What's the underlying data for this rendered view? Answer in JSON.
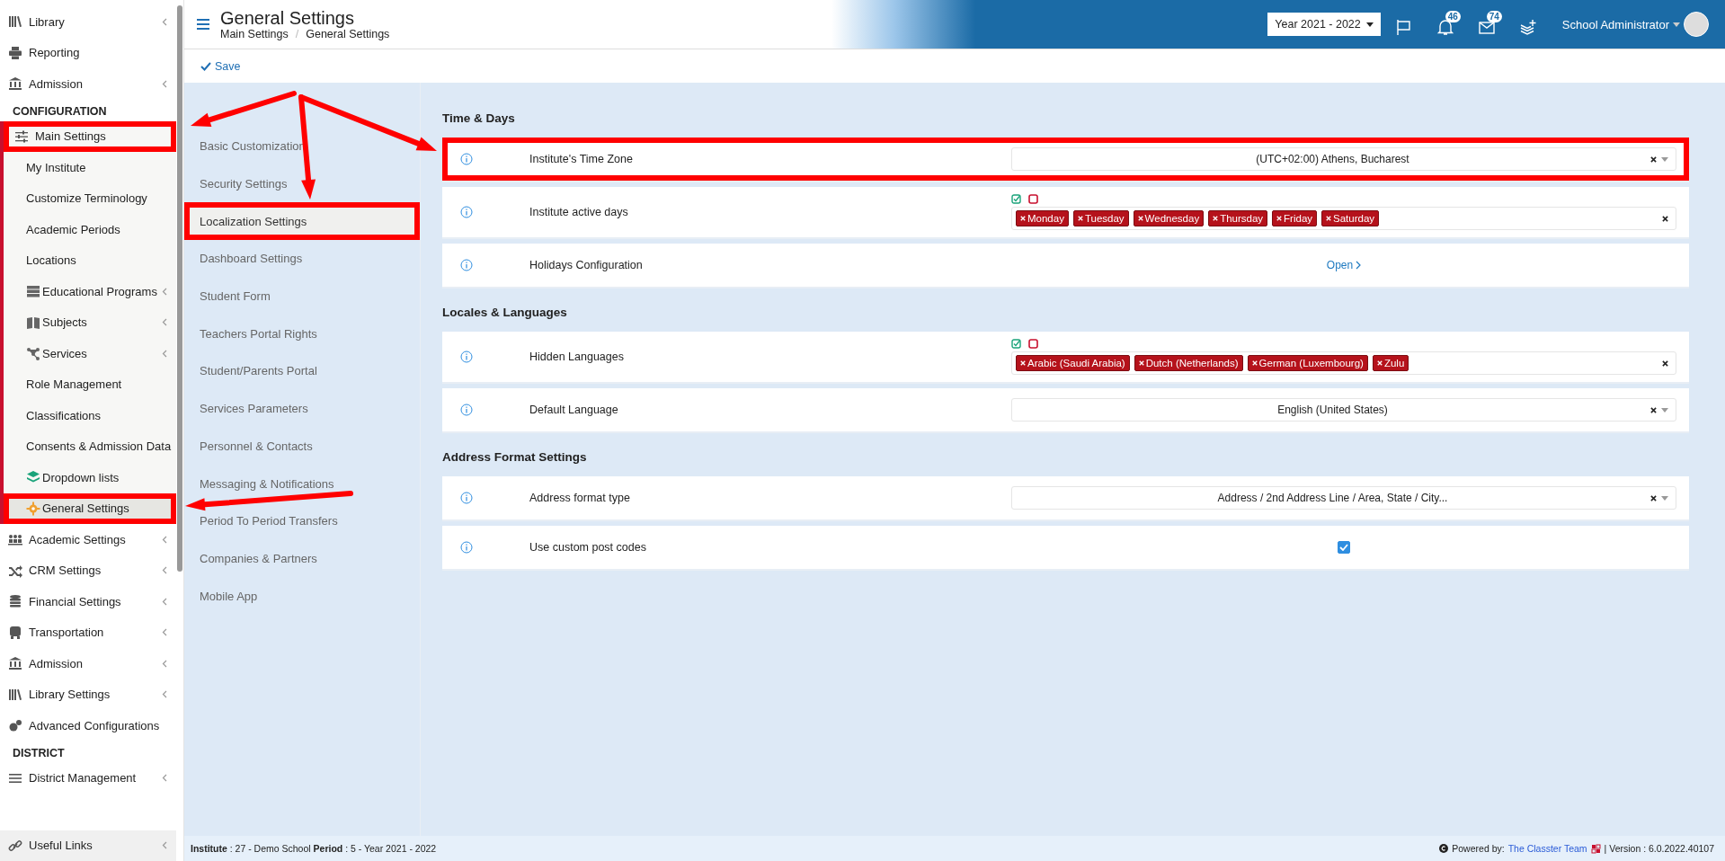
{
  "sidebar": {
    "items": [
      {
        "kind": "item",
        "label": "Library",
        "has_submenu": true,
        "highlighted": false
      },
      {
        "kind": "item",
        "label": "Reporting",
        "has_submenu": false,
        "highlighted": false
      },
      {
        "kind": "item",
        "label": "Admission",
        "has_submenu": true,
        "highlighted": false
      },
      {
        "kind": "heading",
        "label": "CONFIGURATION"
      },
      {
        "kind": "item",
        "label": "Main Settings",
        "has_submenu": false,
        "highlighted": true,
        "expanded": true,
        "children": [
          {
            "label": "My Institute",
            "has_submenu": false,
            "selected": false,
            "highlighted": false
          },
          {
            "label": "Customize Terminology",
            "has_submenu": false,
            "selected": false,
            "highlighted": false
          },
          {
            "label": "Academic Periods",
            "has_submenu": false,
            "selected": false,
            "highlighted": false
          },
          {
            "label": "Locations",
            "has_submenu": false,
            "selected": false,
            "highlighted": false
          },
          {
            "label": "Educational Programs",
            "has_submenu": true,
            "selected": false,
            "highlighted": false
          },
          {
            "label": "Subjects",
            "has_submenu": true,
            "selected": false,
            "highlighted": false
          },
          {
            "label": "Services",
            "has_submenu": true,
            "selected": false,
            "highlighted": false
          },
          {
            "label": "Role Management",
            "has_submenu": false,
            "selected": false,
            "highlighted": false
          },
          {
            "label": "Classifications",
            "has_submenu": false,
            "selected": false,
            "highlighted": false
          },
          {
            "label": "Consents & Admission Data",
            "has_submenu": false,
            "selected": false,
            "highlighted": false
          },
          {
            "label": "Dropdown lists",
            "has_submenu": false,
            "selected": false,
            "highlighted": false
          },
          {
            "label": "General Settings",
            "has_submenu": false,
            "selected": true,
            "highlighted": true
          }
        ]
      },
      {
        "kind": "item",
        "label": "Academic Settings",
        "has_submenu": true,
        "highlighted": false
      },
      {
        "kind": "item",
        "label": "CRM Settings",
        "has_submenu": true,
        "highlighted": false
      },
      {
        "kind": "item",
        "label": "Financial Settings",
        "has_submenu": true,
        "highlighted": false
      },
      {
        "kind": "item",
        "label": "Transportation",
        "has_submenu": true,
        "highlighted": false
      },
      {
        "kind": "item",
        "label": "Admission",
        "has_submenu": true,
        "highlighted": false
      },
      {
        "kind": "item",
        "label": "Library Settings",
        "has_submenu": true,
        "highlighted": false
      },
      {
        "kind": "item",
        "label": "Advanced Configurations",
        "has_submenu": false,
        "highlighted": false
      },
      {
        "kind": "heading",
        "label": "DISTRICT"
      },
      {
        "kind": "item",
        "label": "District Management",
        "has_submenu": true,
        "highlighted": false
      }
    ],
    "bottom_link": {
      "label": "Useful Links",
      "has_submenu": true
    }
  },
  "header": {
    "title": "General Settings",
    "breadcrumb": [
      "Main Settings",
      "General Settings"
    ],
    "breadcrumb_separator": "/",
    "year_selector": "Year 2021 - 2022",
    "notifications_badge": "46",
    "messages_badge": "74",
    "user_name": "School Administrator"
  },
  "toolbar": {
    "save": "Save"
  },
  "settings_nav": [
    {
      "label": "Basic Customization",
      "selected": false,
      "highlighted": false
    },
    {
      "label": "Security Settings",
      "selected": false,
      "highlighted": false
    },
    {
      "label": "Localization Settings",
      "selected": true,
      "highlighted": true
    },
    {
      "label": "Dashboard Settings",
      "selected": false,
      "highlighted": false
    },
    {
      "label": "Student Form",
      "selected": false,
      "highlighted": false
    },
    {
      "label": "Teachers Portal Rights",
      "selected": false,
      "highlighted": false
    },
    {
      "label": "Student/Parents Portal",
      "selected": false,
      "highlighted": false
    },
    {
      "label": "Services Parameters",
      "selected": false,
      "highlighted": false
    },
    {
      "label": "Personnel & Contacts",
      "selected": false,
      "highlighted": false
    },
    {
      "label": "Messaging & Notifications",
      "selected": false,
      "highlighted": false
    },
    {
      "label": "Period To Period Transfers",
      "selected": false,
      "highlighted": false
    },
    {
      "label": "Companies & Partners",
      "selected": false,
      "highlighted": false
    },
    {
      "label": "Mobile App",
      "selected": false,
      "highlighted": false
    }
  ],
  "sections": [
    {
      "title": "Time & Days",
      "rows": [
        {
          "kind": "select",
          "label": "Institute's Time Zone",
          "value": "(UTC+02:00) Athens, Bucharest",
          "highlighted": true
        },
        {
          "kind": "tags",
          "label": "Institute active days",
          "tags": [
            "Monday",
            "Tuesday",
            "Wednesday",
            "Thursday",
            "Friday",
            "Saturday"
          ],
          "highlighted": false
        },
        {
          "kind": "link",
          "label": "Holidays Configuration",
          "value": "Open",
          "highlighted": false
        }
      ]
    },
    {
      "title": "Locales & Languages",
      "rows": [
        {
          "kind": "tags",
          "label": "Hidden Languages",
          "tags": [
            "Arabic (Saudi Arabia)",
            "Dutch (Netherlands)",
            "German (Luxembourg)",
            "Zulu"
          ],
          "highlighted": false
        },
        {
          "kind": "select",
          "label": "Default Language",
          "value": "English (United States)",
          "highlighted": false
        }
      ]
    },
    {
      "title": "Address Format Settings",
      "rows": [
        {
          "kind": "select",
          "label": "Address format type",
          "value": "Address / 2nd Address Line / Area, State / City...",
          "highlighted": false
        },
        {
          "kind": "checkbox",
          "label": "Use custom post codes",
          "checked": true,
          "highlighted": false
        }
      ]
    }
  ],
  "footer": {
    "context": "**Institute** : 27 - Demo School **Period** : 5 - Year 2021 - 2022",
    "powered_by": "Powered by:",
    "powered_link": "The Classter Team",
    "version": "| Version : 6.0.2022.40107"
  }
}
